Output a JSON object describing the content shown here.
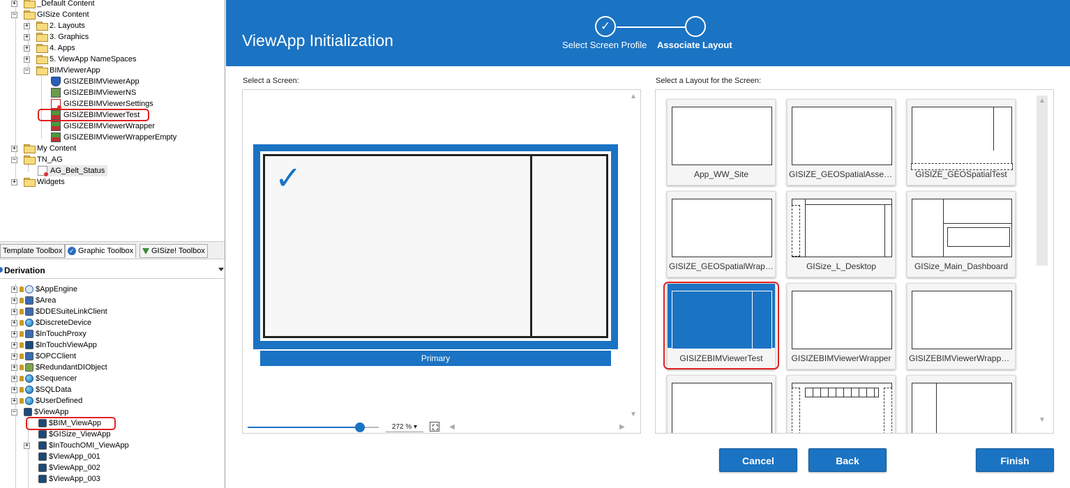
{
  "tree": {
    "items": [
      {
        "label": "_Default Content"
      },
      {
        "label": "GISize Content"
      },
      {
        "label": "2. Layouts"
      },
      {
        "label": "3. Graphics"
      },
      {
        "label": "4. Apps"
      },
      {
        "label": "5. ViewApp NameSpaces"
      },
      {
        "label": "BIMViewerApp"
      },
      {
        "label": "GISIZEBIMViewerApp"
      },
      {
        "label": "GISIZEBIMViewerNS"
      },
      {
        "label": "GISIZEBIMViewerSettings"
      },
      {
        "label": "GISIZEBIMViewerTest"
      },
      {
        "label": "GISIZEBIMViewerWrapper"
      },
      {
        "label": "GISIZEBIMViewerWrapperEmpty"
      },
      {
        "label": "My Content"
      },
      {
        "label": "TN_AG"
      },
      {
        "label": "AG_Belt_Status"
      },
      {
        "label": "Widgets"
      }
    ]
  },
  "toolbox_tabs": [
    "Template Toolbox",
    "Graphic Toolbox",
    "GISize! Toolbox"
  ],
  "derivation": {
    "header": "Derivation",
    "items": [
      {
        "label": "$AppEngine"
      },
      {
        "label": "$Area"
      },
      {
        "label": "$DDESuiteLinkClient"
      },
      {
        "label": "$DiscreteDevice"
      },
      {
        "label": "$InTouchProxy"
      },
      {
        "label": "$InTouchViewApp"
      },
      {
        "label": "$OPCClient"
      },
      {
        "label": "$RedundantDIObject"
      },
      {
        "label": "$Sequencer"
      },
      {
        "label": "$SQLData"
      },
      {
        "label": "$UserDefined"
      },
      {
        "label": "$ViewApp"
      },
      {
        "label": "$BIM_ViewApp"
      },
      {
        "label": "$GISize_ViewApp"
      },
      {
        "label": "$InTouchOMI_ViewApp"
      },
      {
        "label": "$ViewApp_001"
      },
      {
        "label": "$ViewApp_002"
      },
      {
        "label": "$ViewApp_003"
      }
    ]
  },
  "dialog": {
    "title": "ViewApp Initialization",
    "steps": [
      "Select Screen Profile",
      "Associate Layout"
    ],
    "select_screen_label": "Select a Screen:",
    "select_layout_label": "Select a Layout for the Screen:",
    "screen_name": "Primary",
    "zoom": "272 %",
    "layouts": [
      {
        "name": "App_WW_Site"
      },
      {
        "name": "GISIZE_GEOSpatialAssets..."
      },
      {
        "name": "GISIZE_GEOSpatialTest"
      },
      {
        "name": "GISIZE_GEOSpatialWrapper"
      },
      {
        "name": "GISize_L_Desktop"
      },
      {
        "name": "GISize_Main_Dashboard"
      },
      {
        "name": "GISIZEBIMViewerTest"
      },
      {
        "name": "GISIZEBIMViewerWrapper"
      },
      {
        "name": "GISIZEBIMViewerWrapper..."
      },
      {
        "name": ""
      },
      {
        "name": ""
      },
      {
        "name": ""
      }
    ],
    "buttons": {
      "cancel": "Cancel",
      "back": "Back",
      "finish": "Finish"
    }
  },
  "colors": {
    "accent": "#1b73c3",
    "highlight": "#e02020"
  }
}
